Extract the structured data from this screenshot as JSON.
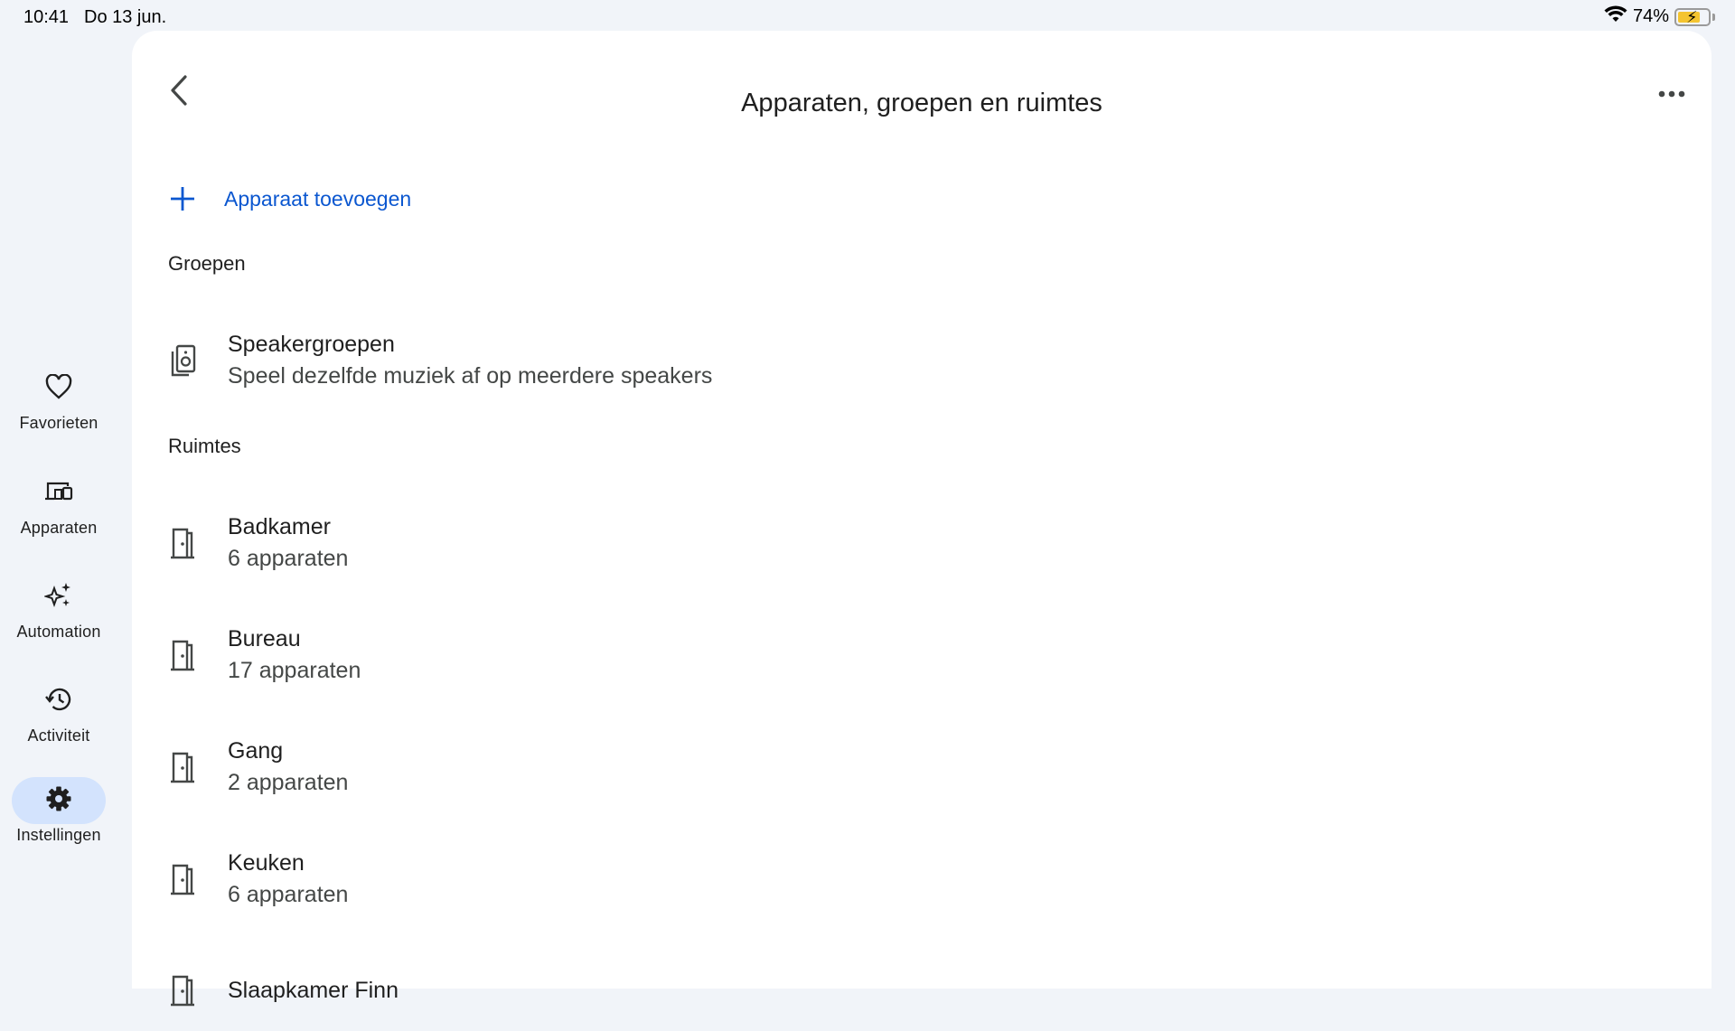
{
  "status_bar": {
    "time": "10:41",
    "date": "Do 13 jun.",
    "battery_percent": "74%",
    "battery_level": 0.74,
    "wifi_icon": "wifi-icon",
    "battery_color": "#f4c430"
  },
  "nav_rail": {
    "items": [
      {
        "label": "Favorieten",
        "icon": "heart-icon",
        "active": false
      },
      {
        "label": "Apparaten",
        "icon": "devices-icon",
        "active": false
      },
      {
        "label": "Automation",
        "icon": "sparkle-icon",
        "active": false
      },
      {
        "label": "Activiteit",
        "icon": "history-icon",
        "active": false
      },
      {
        "label": "Instellingen",
        "icon": "gear-icon",
        "active": true
      }
    ],
    "active_color": "#d3e3fd"
  },
  "header": {
    "title": "Apparaten, groepen en ruimtes",
    "back_icon": "back-chevron-icon",
    "more_icon": "more-horizontal-icon"
  },
  "add_device": {
    "label": "Apparaat toevoegen",
    "icon": "plus-icon",
    "color": "#0b57d0"
  },
  "groups": {
    "heading": "Groepen",
    "items": [
      {
        "title": "Speakergroepen",
        "subtitle": "Speel dezelfde muziek af op meerdere speakers",
        "icon": "speaker-group-icon"
      }
    ]
  },
  "rooms": {
    "heading": "Ruimtes",
    "items": [
      {
        "title": "Badkamer",
        "subtitle": "6 apparaten",
        "icon": "door-icon"
      },
      {
        "title": "Bureau",
        "subtitle": "17 apparaten",
        "icon": "door-icon"
      },
      {
        "title": "Gang",
        "subtitle": "2 apparaten",
        "icon": "door-icon"
      },
      {
        "title": "Keuken",
        "subtitle": "6 apparaten",
        "icon": "door-icon"
      },
      {
        "title": "Slaapkamer Finn",
        "subtitle": "",
        "icon": "door-icon"
      }
    ]
  }
}
